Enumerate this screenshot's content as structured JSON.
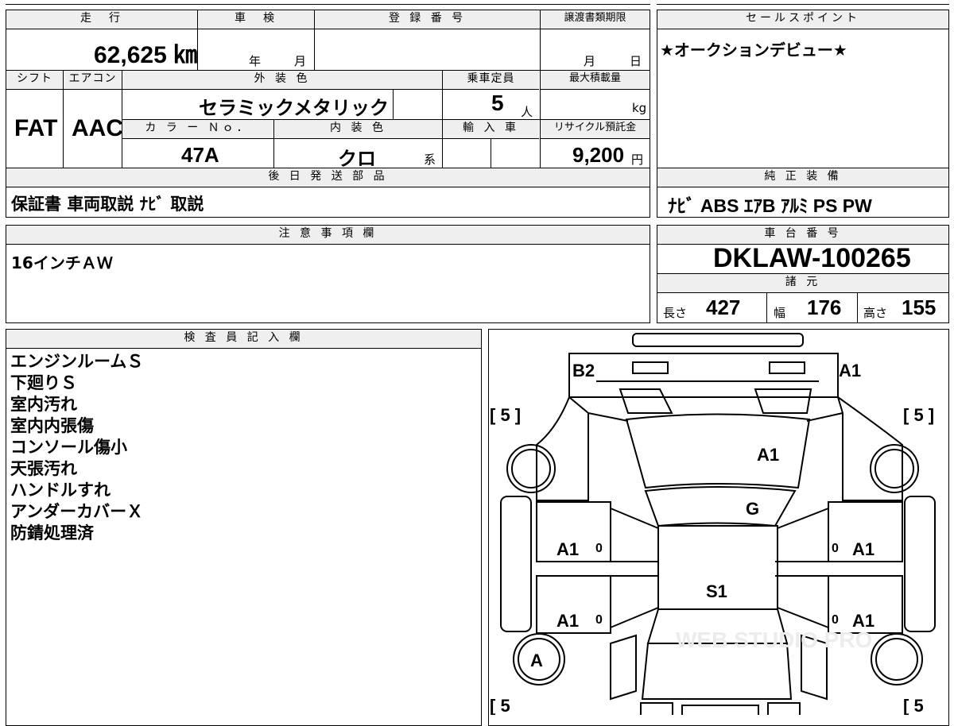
{
  "top": {
    "mileage_header": "走　行",
    "mileage": "62,625 ㎞",
    "inspection_header": "車　検",
    "inspection_year": "年",
    "inspection_month": "月",
    "reg_header": "登 録 番 号",
    "transfer_header": "譲渡書類期限",
    "transfer_month": "月",
    "transfer_day": "日",
    "shift_header": "シフト",
    "shift": "FAT",
    "ac_header": "エアコン",
    "ac": "AAC",
    "exterior_header": "外 装 色",
    "exterior_color": "セラミックメタリック",
    "color_no_header": "カ ラ ー Ｎｏ．",
    "color_no": "47A",
    "interior_header": "内 装 色",
    "interior_color": "クロ",
    "interior_suffix": "系",
    "capacity_header": "乗車定員",
    "capacity": "5",
    "capacity_unit": "人",
    "import_header": "輸 入 車",
    "max_load_header": "最大積載量",
    "max_load_unit": "kg",
    "recycle_header": "リサイクル預託金",
    "recycle_fee": "9,200",
    "recycle_unit": "円"
  },
  "sales_point": {
    "header": "セールスポイント",
    "text": "★オークションデビュー★"
  },
  "later_parts": {
    "header": "後 日 発 送 部 品",
    "text": "保証書 車両取説 ﾅﾋﾞ 取説"
  },
  "genuine_equipment": {
    "header": "純 正 装 備",
    "text": "ﾅﾋﾞ ABS ｴｱB ｱﾙﾐ PS PW"
  },
  "notes": {
    "header": "注 意 事 項 欄",
    "text": "16インチＡＷ"
  },
  "chassis": {
    "header": "車 台 番 号",
    "number": "DKLAW-100265",
    "spec_header": "諸 元",
    "length_label": "長さ",
    "length": "427",
    "width_label": "幅",
    "width": "176",
    "height_label": "高さ",
    "height": "155"
  },
  "inspector": {
    "header": "検 査 員 記 入 欄",
    "lines": [
      "エンジンルームＳ",
      "下廻りＳ",
      "室内汚れ",
      "室内内張傷",
      "コンソール傷小",
      "天張汚れ",
      "ハンドルすれ",
      "アンダーカバーＸ",
      "防錆処理済"
    ]
  },
  "diagram": {
    "b2": "B2",
    "a1_top_right": "A1",
    "tire_tl": "[ 5 ]",
    "tire_tr": "[ 5 ]",
    "tire_bl": "[ 5",
    "tire_br": "[ 5",
    "hood": "A1",
    "windshield": "G",
    "door_fl": "A1",
    "door_fr": "A1",
    "roof": "S1",
    "door_rl": "A1",
    "door_rr": "A1",
    "wheel_rl": "A",
    "pillar": "0",
    "watermark": "WEB STUDIO PRO"
  }
}
